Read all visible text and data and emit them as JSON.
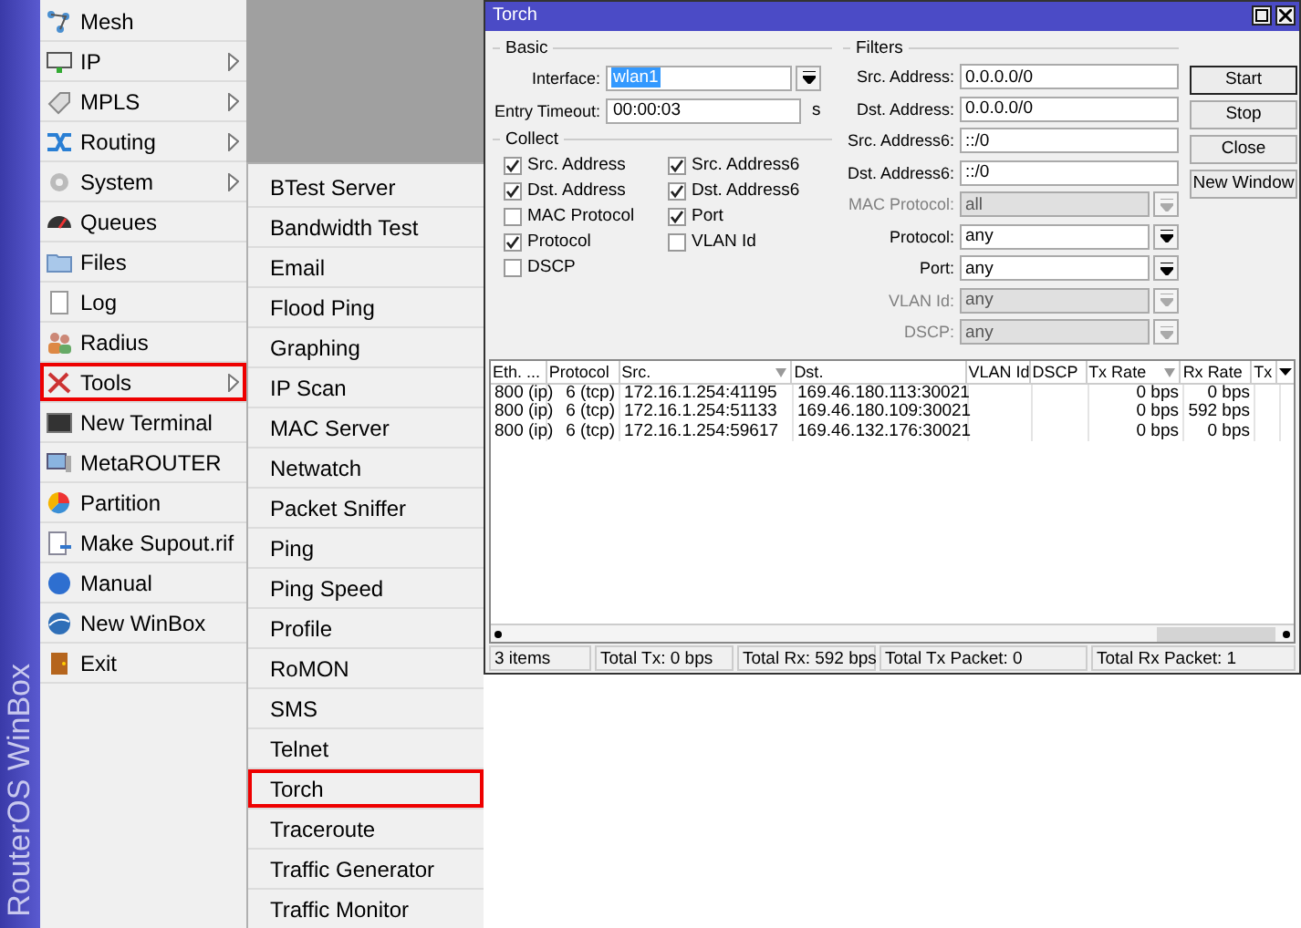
{
  "brand": "RouterOS WinBox",
  "menu": [
    {
      "label": "Mesh",
      "submenu": false,
      "highlighted": false
    },
    {
      "label": "IP",
      "submenu": true,
      "highlighted": false
    },
    {
      "label": "MPLS",
      "submenu": true,
      "highlighted": false
    },
    {
      "label": "Routing",
      "submenu": true,
      "highlighted": false
    },
    {
      "label": "System",
      "submenu": true,
      "highlighted": false
    },
    {
      "label": "Queues",
      "submenu": false,
      "highlighted": false
    },
    {
      "label": "Files",
      "submenu": false,
      "highlighted": false
    },
    {
      "label": "Log",
      "submenu": false,
      "highlighted": false
    },
    {
      "label": "Radius",
      "submenu": false,
      "highlighted": false
    },
    {
      "label": "Tools",
      "submenu": true,
      "highlighted": true
    },
    {
      "label": "New Terminal",
      "submenu": false,
      "highlighted": false
    },
    {
      "label": "MetaROUTER",
      "submenu": false,
      "highlighted": false
    },
    {
      "label": "Partition",
      "submenu": false,
      "highlighted": false
    },
    {
      "label": "Make Supout.rif",
      "submenu": false,
      "highlighted": false
    },
    {
      "label": "Manual",
      "submenu": false,
      "highlighted": false
    },
    {
      "label": "New WinBox",
      "submenu": false,
      "highlighted": false
    },
    {
      "label": "Exit",
      "submenu": false,
      "highlighted": false
    }
  ],
  "submenu": [
    {
      "label": "BTest Server",
      "highlighted": false
    },
    {
      "label": "Bandwidth Test",
      "highlighted": false
    },
    {
      "label": "Email",
      "highlighted": false
    },
    {
      "label": "Flood Ping",
      "highlighted": false
    },
    {
      "label": "Graphing",
      "highlighted": false
    },
    {
      "label": "IP Scan",
      "highlighted": false
    },
    {
      "label": "MAC Server",
      "highlighted": false
    },
    {
      "label": "Netwatch",
      "highlighted": false
    },
    {
      "label": "Packet Sniffer",
      "highlighted": false
    },
    {
      "label": "Ping",
      "highlighted": false
    },
    {
      "label": "Ping Speed",
      "highlighted": false
    },
    {
      "label": "Profile",
      "highlighted": false
    },
    {
      "label": "RoMON",
      "highlighted": false
    },
    {
      "label": "SMS",
      "highlighted": false
    },
    {
      "label": "Telnet",
      "highlighted": false
    },
    {
      "label": "Torch",
      "highlighted": true
    },
    {
      "label": "Traceroute",
      "highlighted": false
    },
    {
      "label": "Traffic Generator",
      "highlighted": false
    },
    {
      "label": "Traffic Monitor",
      "highlighted": false
    }
  ],
  "window": {
    "title": "Torch",
    "basic": {
      "title": "Basic",
      "fields": [
        {
          "label": "Interface:",
          "value": "wlan1",
          "selected": true,
          "dropdown": true
        },
        {
          "label": "Entry Timeout:",
          "value": "00:00:03",
          "selected": false,
          "dropdown": false,
          "unit": "s"
        }
      ]
    },
    "collect": {
      "title": "Collect",
      "checkboxes": [
        {
          "label": "Src. Address",
          "checked": true
        },
        {
          "label": "Src. Address6",
          "checked": true
        },
        {
          "label": "Dst. Address",
          "checked": true
        },
        {
          "label": "Dst. Address6",
          "checked": true
        },
        {
          "label": "MAC Protocol",
          "checked": false
        },
        {
          "label": "Port",
          "checked": true
        },
        {
          "label": "Protocol",
          "checked": true
        },
        {
          "label": "VLAN Id",
          "checked": false
        },
        {
          "label": "DSCP",
          "checked": false
        }
      ]
    },
    "filters": {
      "title": "Filters",
      "fields": [
        {
          "label": "Src. Address:",
          "value": "0.0.0.0/0",
          "disabled": false,
          "dropdown": false
        },
        {
          "label": "Dst. Address:",
          "value": "0.0.0.0/0",
          "disabled": false,
          "dropdown": false
        },
        {
          "label": "Src. Address6:",
          "value": "::/0",
          "disabled": false,
          "dropdown": false
        },
        {
          "label": "Dst. Address6:",
          "value": "::/0",
          "disabled": false,
          "dropdown": false
        },
        {
          "label": "MAC Protocol:",
          "value": "all",
          "disabled": true,
          "dropdown": true
        },
        {
          "label": "Protocol:",
          "value": "any",
          "disabled": false,
          "dropdown": true
        },
        {
          "label": "Port:",
          "value": "any",
          "disabled": false,
          "dropdown": true
        },
        {
          "label": "VLAN Id:",
          "value": "any",
          "disabled": true,
          "dropdown": true
        },
        {
          "label": "DSCP:",
          "value": "any",
          "disabled": true,
          "dropdown": true
        }
      ]
    },
    "buttons": [
      {
        "label": "Start",
        "default": true
      },
      {
        "label": "Stop",
        "default": false
      },
      {
        "label": "Close",
        "default": false
      },
      {
        "label": "New Window",
        "default": false
      }
    ],
    "table": {
      "columns": [
        {
          "label": "Eth. ...",
          "sorted": false
        },
        {
          "label": "Protocol",
          "sorted": false
        },
        {
          "label": "Src.",
          "sorted": true
        },
        {
          "label": "Dst.",
          "sorted": false
        },
        {
          "label": "VLAN Id",
          "sorted": false
        },
        {
          "label": "DSCP",
          "sorted": false
        },
        {
          "label": "Tx Rate",
          "sorted": true
        },
        {
          "label": "Rx Rate",
          "sorted": false
        },
        {
          "label": "Tx",
          "sorted": false
        }
      ],
      "rows": [
        [
          "800 (ip)",
          "6 (tcp)",
          "172.16.1.254:41195",
          "169.46.180.113:30021",
          "",
          "",
          "0 bps",
          "0 bps",
          ""
        ],
        [
          "800 (ip)",
          "6 (tcp)",
          "172.16.1.254:51133",
          "169.46.180.109:30021",
          "",
          "",
          "0 bps",
          "592 bps",
          ""
        ],
        [
          "800 (ip)",
          "6 (tcp)",
          "172.16.1.254:59617",
          "169.46.132.176:30021",
          "",
          "",
          "0 bps",
          "0 bps",
          ""
        ]
      ]
    },
    "status_bar": [
      "3 items",
      "Total Tx: 0 bps",
      "Total Rx: 592 bps",
      "Total Tx Packet: 0",
      "Total Rx Packet: 1"
    ]
  }
}
